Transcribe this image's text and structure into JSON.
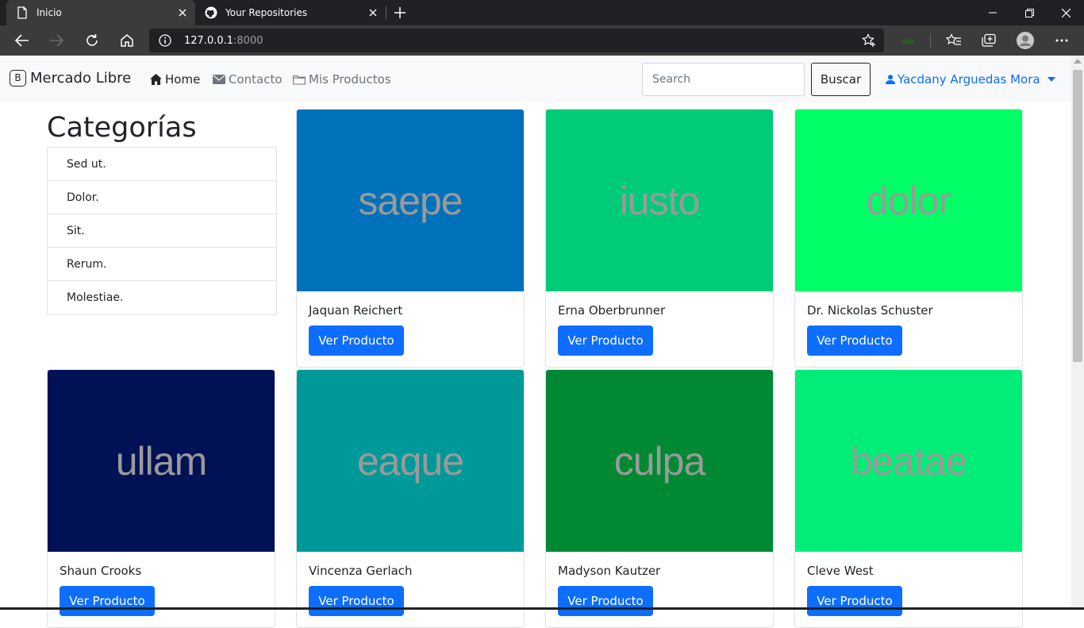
{
  "browser": {
    "tabs": [
      {
        "title": "Inicio",
        "active": true
      },
      {
        "title": "Your Repositories",
        "active": false
      }
    ],
    "url": {
      "host": "127.0.0.1",
      "port": ":8000"
    }
  },
  "navbar": {
    "brand_logo": "B",
    "brand": "Mercado Libre",
    "links": [
      {
        "label": "Home",
        "icon": "house-icon"
      },
      {
        "label": "Contacto",
        "icon": "envelope-icon"
      },
      {
        "label": "Mis Productos",
        "icon": "folder-icon"
      }
    ],
    "search": {
      "placeholder": "Search",
      "button": "Buscar"
    },
    "user": "Yacdany Arguedas Mora"
  },
  "categories": {
    "title": "Categorías",
    "items": [
      "Sed ut.",
      "Dolor.",
      "Sit.",
      "Rerum.",
      "Molestiae."
    ]
  },
  "products": [
    {
      "image_text": "saepe",
      "color": "#0071bb",
      "name": "Jaquan Reichert",
      "button": "Ver Producto"
    },
    {
      "image_text": "iusto",
      "color": "#00cc77",
      "name": "Erna Oberbrunner",
      "button": "Ver Producto"
    },
    {
      "image_text": "dolor",
      "color": "#00ff66",
      "name": "Dr. Nickolas Schuster",
      "button": "Ver Producto"
    },
    {
      "image_text": "ullam",
      "color": "#001155",
      "name": "Shaun Crooks",
      "button": "Ver Producto"
    },
    {
      "image_text": "eaque",
      "color": "#009999",
      "name": "Vincenza Gerlach",
      "button": "Ver Producto"
    },
    {
      "image_text": "culpa",
      "color": "#008833",
      "name": "Madyson Kautzer",
      "button": "Ver Producto"
    },
    {
      "image_text": "beatae",
      "color": "#00ee77",
      "name": "Cleve West",
      "button": "Ver Producto"
    }
  ]
}
